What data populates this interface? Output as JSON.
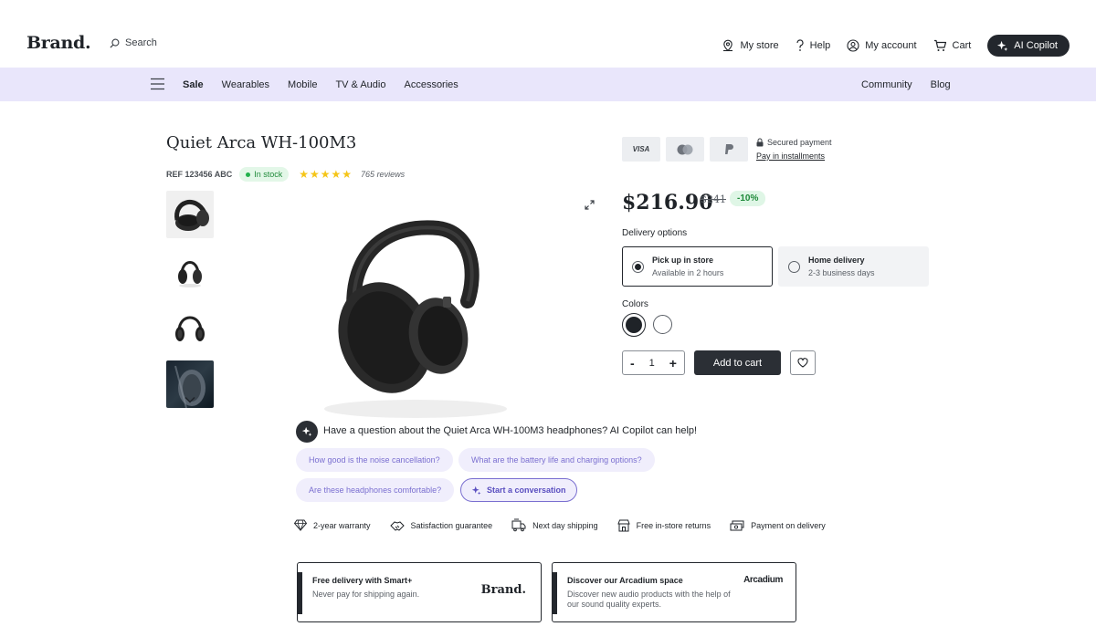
{
  "header": {
    "logo": "Brand.",
    "search_label": "Search",
    "links": {
      "store": "My store",
      "help": "Help",
      "account": "My account",
      "cart": "Cart",
      "copilot": "AI Copilot"
    }
  },
  "menu": {
    "categories": [
      "Sale",
      "Wearables",
      "Mobile",
      "TV & Audio",
      "Accessories"
    ],
    "right": [
      "Community",
      "Blog"
    ]
  },
  "product": {
    "title": "Quiet Arca WH-100M3",
    "ref": "REF 123456 ABC",
    "stock": "In stock",
    "rating": 5,
    "reviews": "765 reviews"
  },
  "payment": {
    "cards": [
      "VISA",
      "Mastercard",
      "PayPal"
    ],
    "secured": "Secured payment",
    "installments": "Pay in installments"
  },
  "pricing": {
    "price": "$216.90",
    "old_price": "$241",
    "discount": "-10%"
  },
  "delivery": {
    "label": "Delivery options",
    "options": [
      {
        "title": "Pick up in store",
        "sub": "Available in 2 hours",
        "selected": true
      },
      {
        "title": "Home delivery",
        "sub": "2-3 business days",
        "selected": false
      }
    ]
  },
  "colors": {
    "label": "Colors",
    "swatches": [
      "#1f2328",
      "#ffffff"
    ],
    "selected": 0
  },
  "cart": {
    "quantity": "1",
    "minus": "-",
    "plus": "+",
    "add_label": "Add to cart"
  },
  "copilot": {
    "question": "Have a question about the Quiet Arca WH-100M3 headphones? AI Copilot can help!",
    "chips": [
      "How good is the noise cancellation?",
      "What are the battery life and charging options?",
      "Are these headphones comfortable?"
    ],
    "start": "Start a conversation"
  },
  "perks": [
    "2-year warranty",
    "Satisfaction guarantee",
    "Next day shipping",
    "Free in-store returns",
    "Payment on delivery"
  ],
  "promos": [
    {
      "title": "Free delivery with Smart+",
      "sub": "Never pay for shipping again.",
      "logo": "Brand."
    },
    {
      "title": "Discover our Arcadium space",
      "sub": "Discover new audio products with the help of our sound quality experts.",
      "logo": "Arcadium"
    }
  ]
}
